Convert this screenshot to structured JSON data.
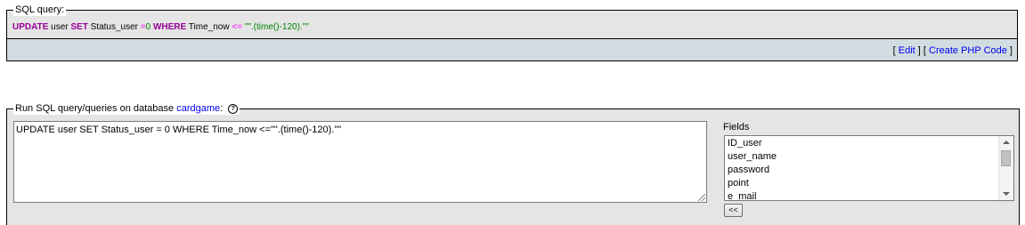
{
  "query_panel": {
    "legend": "SQL query:",
    "sql_tokens": [
      {
        "text": "UPDATE",
        "kind": "kw"
      },
      {
        "text": " user ",
        "kind": "plain"
      },
      {
        "text": "SET",
        "kind": "kw"
      },
      {
        "text": " Status_user ",
        "kind": "plain"
      },
      {
        "text": "=",
        "kind": "op"
      },
      {
        "text": "0",
        "kind": "num"
      },
      {
        "text": " ",
        "kind": "plain"
      },
      {
        "text": "WHERE",
        "kind": "kw"
      },
      {
        "text": " Time_now ",
        "kind": "plain"
      },
      {
        "text": "<=",
        "kind": "op"
      },
      {
        "text": " ",
        "kind": "plain"
      },
      {
        "text": "\"\".(time()-120).\"\"",
        "kind": "str"
      }
    ]
  },
  "edit_bar": {
    "open_bracket_1": "[ ",
    "edit_label": "Edit",
    "close_open": " ] [ ",
    "create_php_label": "Create PHP Code",
    "close_bracket_2": " ]"
  },
  "run_panel": {
    "legend_prefix": "Run SQL query/queries on database ",
    "database_name": "cardgame",
    "legend_suffix": ":",
    "help_icon_glyph": "?",
    "textarea_value": "UPDATE user SET Status_user = 0 WHERE Time_now <=\"\".(time()-120).\"\"",
    "fields_label": "Fields",
    "fields": [
      "ID_user",
      "user_name",
      "password",
      "point",
      "e_mail"
    ],
    "insert_button_label": "<<"
  },
  "colors": {
    "keyword": "#990099",
    "operator": "#ff00ff",
    "literal": "#008000",
    "panel_bg": "#e5e5e5",
    "edit_bar_bg": "#d0dce0",
    "link": "#0000ee"
  }
}
